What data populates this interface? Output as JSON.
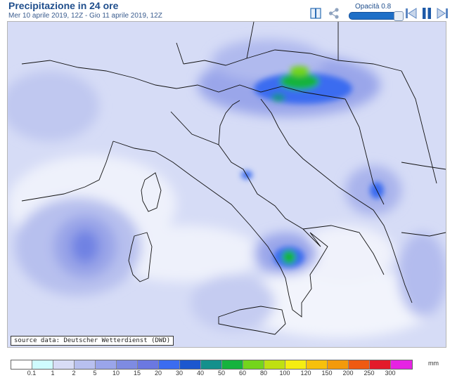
{
  "header": {
    "title": "Precipitazione in 24 ore",
    "subtitle": "Mer 10 aprile 2019, 12Z - Gio 11 aprile 2019, 12Z"
  },
  "toolbar": {
    "opacity_label": "Opacità 0.8",
    "opacity_value": 0.8,
    "icons": [
      "book-icon",
      "share-icon",
      "step-back-icon",
      "pause-icon",
      "step-forward-icon"
    ]
  },
  "map": {
    "source_label": "source data: Deutscher Wetterdienst (DWD)"
  },
  "legend": {
    "unit": "mm",
    "labels": [
      "0.1",
      "1",
      "2",
      "5",
      "10",
      "15",
      "20",
      "30",
      "40",
      "50",
      "60",
      "80",
      "100",
      "120",
      "150",
      "200",
      "250",
      "300"
    ],
    "colors": [
      "#ffffff",
      "#cffcff",
      "#d8dcf6",
      "#b8c0ef",
      "#9aa5ea",
      "#7e8be2",
      "#6b78e1",
      "#3b6cf0",
      "#1c57cf",
      "#14908c",
      "#16b33e",
      "#74d51c",
      "#bfe012",
      "#f5ed12",
      "#f7c00c",
      "#f39a0b",
      "#ef5a12",
      "#e31b2a",
      "#e623e3"
    ]
  }
}
